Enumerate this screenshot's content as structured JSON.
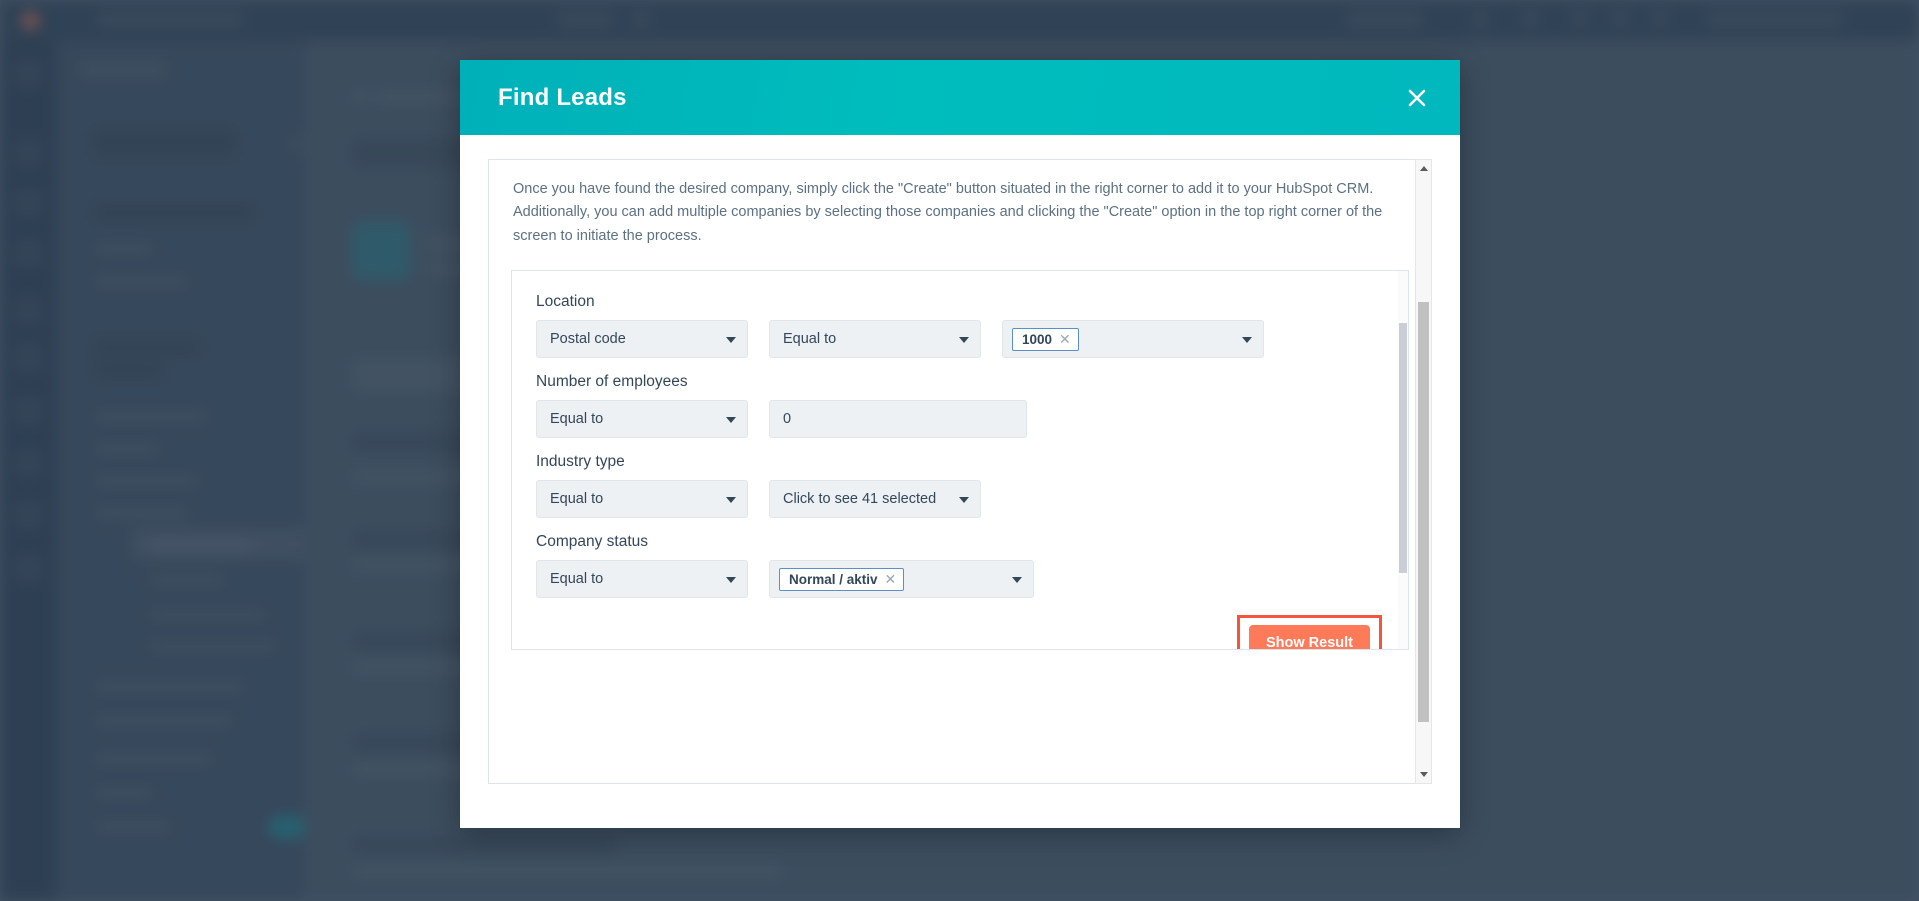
{
  "modal": {
    "title": "Find Leads",
    "close_icon": "close-icon",
    "intro_text": "Once you have found the desired company, simply click the \"Create\" button situated in the right corner to add it to your HubSpot CRM. Additionally, you can add multiple companies by selecting those companies and clicking the \"Create\" option in the top right corner of the screen to initiate the process.",
    "header_color": "#00bdbd"
  },
  "filters": {
    "location": {
      "label": "Location",
      "field_select": "Postal code",
      "operator_select": "Equal to",
      "value_chip": "1000",
      "chip_remove_icon": "remove-chip-icon"
    },
    "employees": {
      "label": "Number of employees",
      "operator_select": "Equal to",
      "value_input": "0",
      "value_placeholder": "0"
    },
    "industry": {
      "label": "Industry type",
      "operator_select": "Equal to",
      "value_select": "Click to see 41 selected"
    },
    "company_status": {
      "label": "Company status",
      "operator_select": "Equal to",
      "value_chip": "Normal / aktiv",
      "chip_remove_icon": "remove-chip-icon"
    }
  },
  "actions": {
    "show_result_label": "Show Result",
    "show_result_color": "#ff7a59",
    "highlight_color": "#f4553f"
  },
  "scroll": {
    "up_arrow_icon": "scroll-up-icon",
    "down_arrow_icon": "scroll-down-icon"
  }
}
